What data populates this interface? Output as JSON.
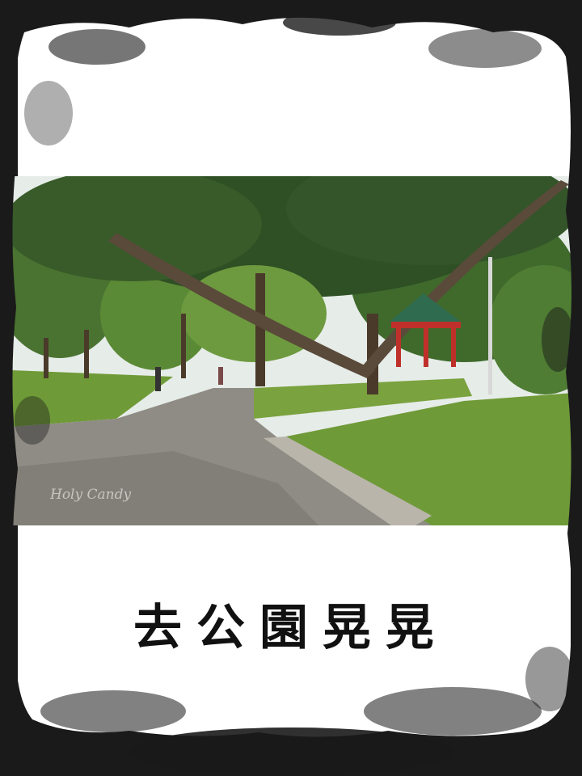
{
  "poster": {
    "title": "去公園晃晃",
    "watermark": "Holy Candy"
  },
  "colors": {
    "frame": "#1a1a1a",
    "paper": "#ffffff",
    "grass": "#6f9a38",
    "pavement": "#8f8c85",
    "foliage": "#3d5f2a",
    "pavilion_pillars": "#c0302a",
    "pavilion_roof": "#2f6b4f"
  }
}
